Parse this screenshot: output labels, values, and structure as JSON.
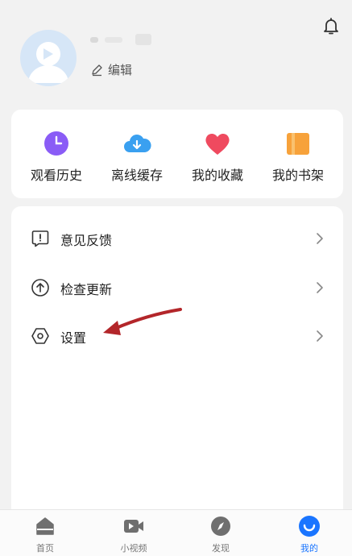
{
  "header": {
    "edit_label": "编辑"
  },
  "shortcuts": [
    {
      "label": "观看历史",
      "icon": "clock-icon",
      "color": "#8a5cf6"
    },
    {
      "label": "离线缓存",
      "icon": "cloud-download-icon",
      "color": "#3aa0f0"
    },
    {
      "label": "我的收藏",
      "icon": "heart-icon",
      "color": "#ef4a5f"
    },
    {
      "label": "我的书架",
      "icon": "book-icon",
      "color": "#f7a23b"
    }
  ],
  "menu": [
    {
      "label": "意见反馈",
      "icon": "feedback-icon"
    },
    {
      "label": "检查更新",
      "icon": "update-icon"
    },
    {
      "label": "设置",
      "icon": "settings-icon"
    }
  ],
  "tabs": [
    {
      "label": "首页",
      "icon": "home-icon"
    },
    {
      "label": "小视频",
      "icon": "video-icon"
    },
    {
      "label": "发现",
      "icon": "compass-icon"
    },
    {
      "label": "我的",
      "icon": "profile-icon",
      "active": true
    }
  ],
  "colors": {
    "accent": "#1a75ff",
    "annotation_arrow": "#b3262a"
  }
}
